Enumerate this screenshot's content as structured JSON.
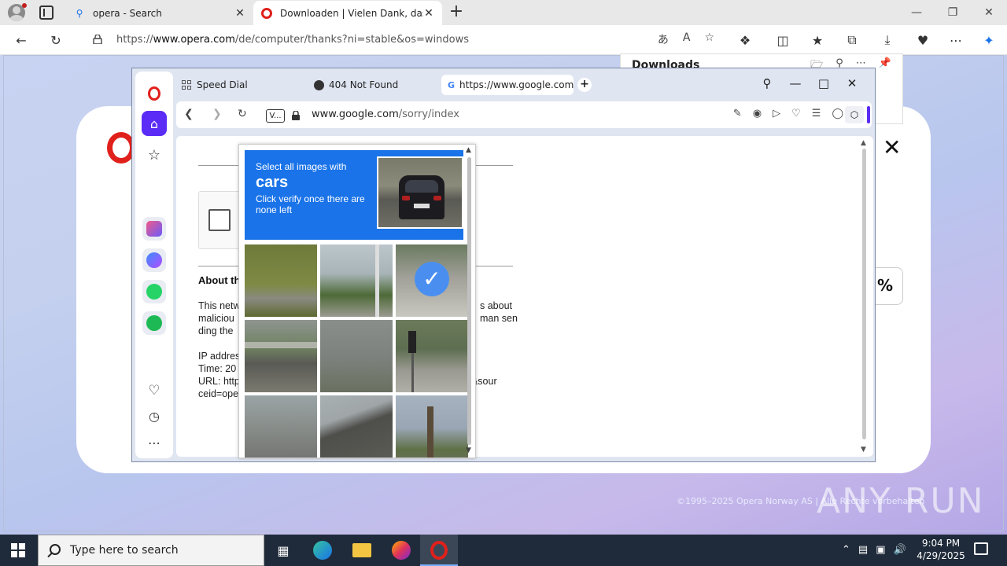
{
  "edge": {
    "tabs": [
      {
        "title": "opera - Search",
        "icon": "search-icon"
      },
      {
        "title": "Downloaden | Vielen Dank, dass Sie...",
        "icon": "opera-icon"
      }
    ],
    "address": {
      "prefix": "https://",
      "domain": "www.opera.com",
      "path": "/de/computer/thanks?ni=stable&os=windows"
    },
    "downloads_panel_title": "Downloads"
  },
  "opera_page": {
    "percent_text": "%",
    "footer": "©1995–2025 Opera Norway AS | Alle Rechte vorbehalten",
    "watermark": "ANY RUN"
  },
  "opera_window": {
    "tabs": [
      {
        "title": "Speed Dial",
        "icon": "speed-dial-icon"
      },
      {
        "title": "404 Not Found",
        "icon": "globe-icon"
      },
      {
        "title": "https://www.google.com/",
        "icon": "google-icon"
      }
    ],
    "url_badge": "V...",
    "address": {
      "domain": "www.google.com",
      "path": "/sorry/index"
    }
  },
  "google_sorry": {
    "about_heading": "About th",
    "para_left": [
      "This netw",
      "maliciou",
      "ding the"
    ],
    "para_right": [
      "s about",
      "man sen"
    ],
    "info_left": [
      "IP addres",
      "Time: 20",
      "URL: http",
      "ceid=ope"
    ],
    "info_right": "g&sour"
  },
  "captcha": {
    "instruction": "Select all images with",
    "target": "cars",
    "subtext": "Click verify once there are none left",
    "tiles": [
      {
        "scene": "road-bushes",
        "selected": false
      },
      {
        "scene": "palm-trees-pole",
        "selected": false
      },
      {
        "scene": "crosswalk",
        "selected": true
      },
      {
        "scene": "overpass",
        "selected": false
      },
      {
        "scene": "curb",
        "selected": false
      },
      {
        "scene": "traffic-light",
        "selected": false
      },
      {
        "scene": "highway-cars",
        "selected": false
      },
      {
        "scene": "rooftop",
        "selected": false
      },
      {
        "scene": "palm-tree",
        "selected": false
      }
    ]
  },
  "taskbar": {
    "search_placeholder": "Type here to search",
    "time": "9:04 PM",
    "date": "4/29/2025"
  }
}
